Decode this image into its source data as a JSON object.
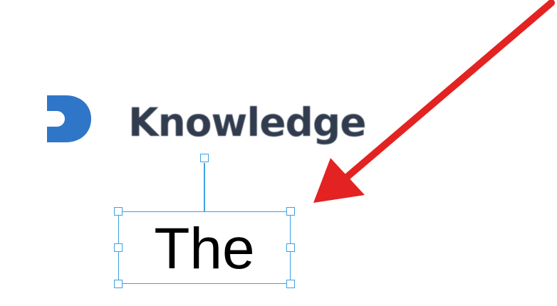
{
  "logo": {
    "icon": "letter-d-logo-icon",
    "text": "Knowledge",
    "brand_color": "#2f76c8",
    "text_color": "#313d4f"
  },
  "text_box": {
    "content": "The",
    "selection_color": "#3ba2e4"
  },
  "annotation": {
    "icon": "red-arrow-icon",
    "color": "#e32222"
  }
}
